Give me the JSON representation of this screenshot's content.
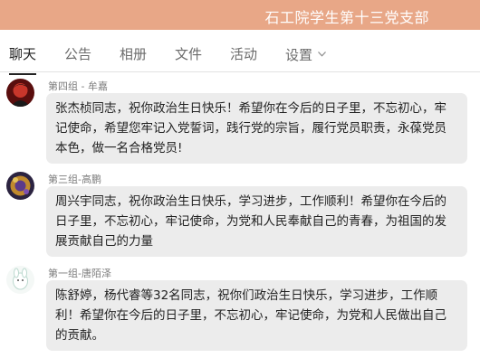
{
  "header": {
    "title": "石工院学生第十三党支部"
  },
  "tabs": [
    {
      "label": "聊天"
    },
    {
      "label": "公告"
    },
    {
      "label": "相册"
    },
    {
      "label": "文件"
    },
    {
      "label": "活动"
    },
    {
      "label": "设置"
    }
  ],
  "messages": [
    {
      "sender": "第四组 - 牟嘉",
      "text": "张杰桢同志，祝你政治生日快乐！希望你在今后的日子里，不忘初心，牢记使命，希望您牢记入党誓词，践行党的宗旨，履行党员职责，永葆党员本色，做一名合格党员!"
    },
    {
      "sender": "第三组-高鹏",
      "text": "周兴宇同志，祝你政治生日快乐，学习进步，工作顺利！希望你在今后的日子里，不忘初心，牢记使命，为党和人民奉献自己的青春，为祖国的发展贡献自己的力量"
    },
    {
      "sender": "第一组-唐陌泽",
      "text": "陈舒婷，杨代睿等32名同志，祝你们政治生日快乐，学习进步，工作顺利！希望你在今后的日子里，不忘初心，牢记使命，为党和人民做出自己的贡献。"
    }
  ]
}
